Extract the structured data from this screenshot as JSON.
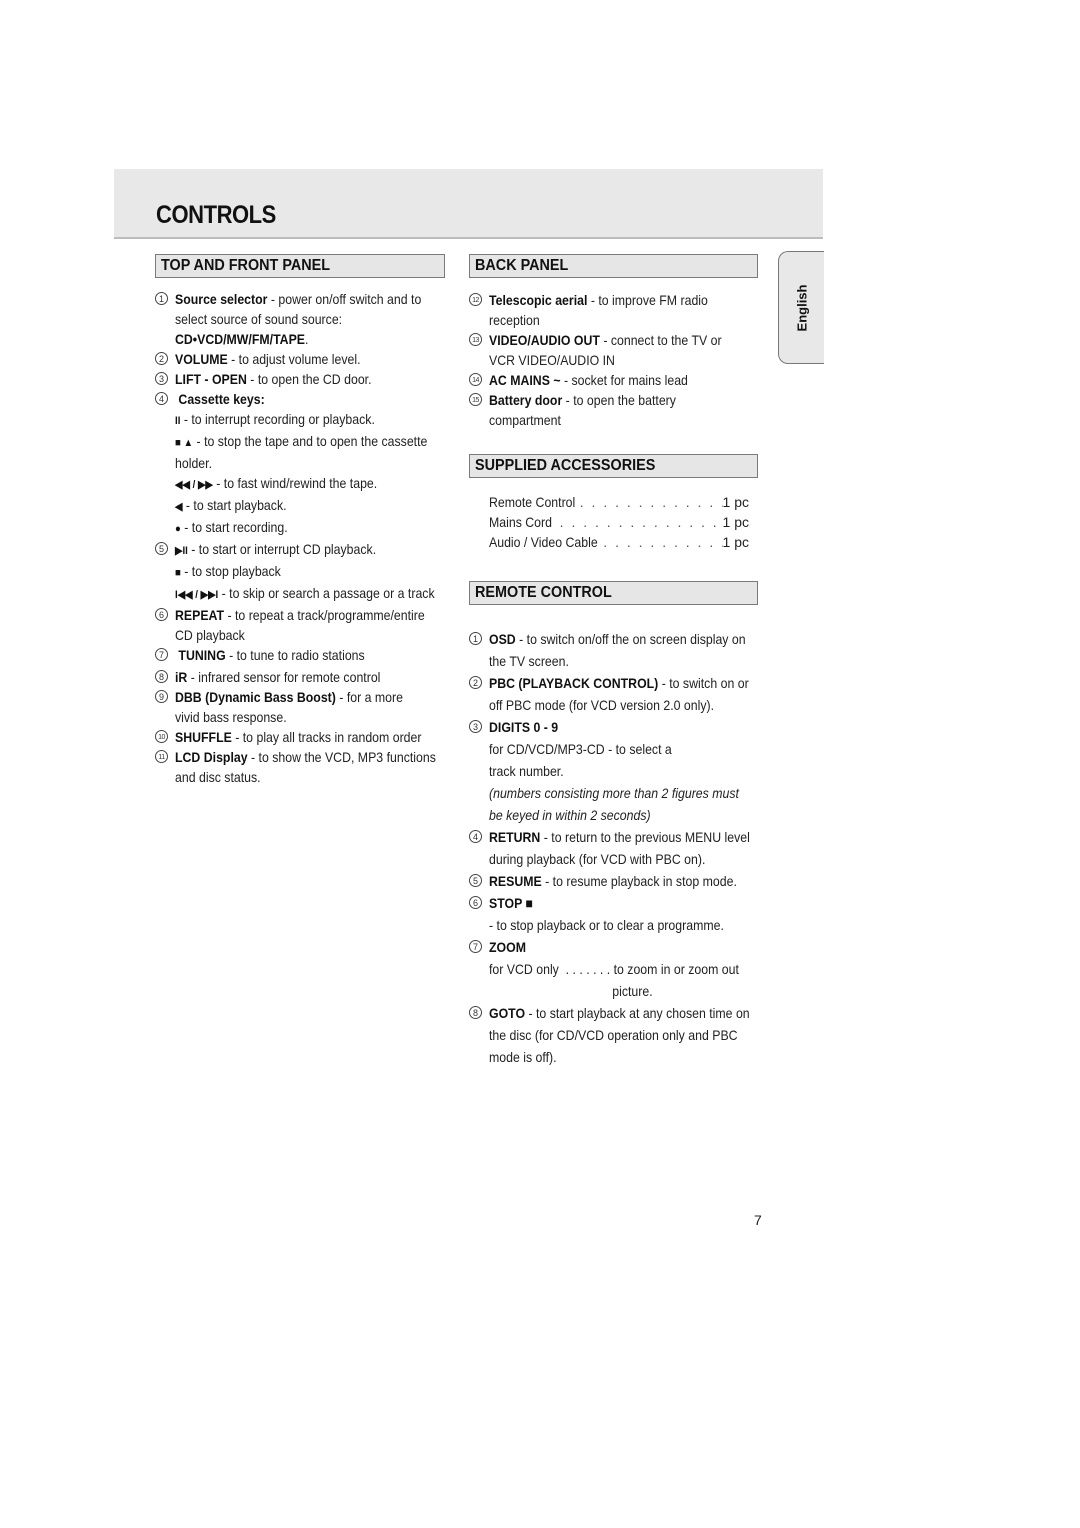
{
  "page": {
    "title": "CONTROLS",
    "language_tab": "English",
    "page_number": "7"
  },
  "top_front_panel": {
    "heading": "TOP AND FRONT PANEL",
    "items": [
      {
        "num": "1",
        "term": "Source selector",
        "desc": " - power on/off switch and to",
        "cont": [
          "select source of sound source:"
        ],
        "sub_bold": "CD•VCD/MW/FM/TAPE",
        "sub_tail": "."
      },
      {
        "num": "2",
        "term": "VOLUME",
        "desc": " - to adjust volume level."
      },
      {
        "num": "3",
        "term": "LIFT - OPEN",
        "desc": " - to open the CD door."
      },
      {
        "num": "4",
        "term": "Cassette keys:",
        "desc": ""
      },
      {
        "num": "5",
        "symbol": "▶II",
        "desc": " - to start or interrupt CD playback."
      },
      {
        "num": "6",
        "term": "REPEAT",
        "desc": " - to repeat a track/programme/entire",
        "cont": [
          "CD playback"
        ]
      },
      {
        "num": "7",
        "term": "TUNING",
        "desc": " - to tune to radio stations"
      },
      {
        "num": "8",
        "term": "iR",
        "desc": " - infrared sensor for remote control"
      },
      {
        "num": "9",
        "term": "DBB (Dynamic Bass Boost)",
        "desc": " -  for a more",
        "cont": [
          "vivid bass response."
        ]
      },
      {
        "num": "10",
        "term": "SHUFFLE",
        "desc": " - to play all tracks in random order"
      },
      {
        "num": "11",
        "term": "LCD Display",
        "desc": " - to show the VCD, MP3 functions",
        "cont": [
          "and disc status."
        ]
      }
    ],
    "cassette_keys": [
      {
        "symbol": "II",
        "desc": " - to interrupt recording or playback."
      },
      {
        "symbol": "■ ▲",
        "desc": " - to stop the tape and to open the cassette",
        "cont": "holder."
      },
      {
        "symbol": "◀◀ / ▶▶",
        "desc": " - to fast wind/rewind the tape."
      },
      {
        "symbol": "◀",
        "desc": " - to start playback."
      },
      {
        "symbol": "●",
        "desc": " - to start recording."
      }
    ],
    "cd_keys": [
      {
        "symbol": "■",
        "desc": " - to stop playback"
      },
      {
        "symbol": "I◀◀ / ▶▶I",
        "desc": " - to skip or search a passage or a track"
      }
    ]
  },
  "back_panel": {
    "heading": "BACK PANEL",
    "items": [
      {
        "num": "12",
        "term": "Telescopic aerial",
        "desc": " - to improve FM radio",
        "cont": "reception"
      },
      {
        "num": "13",
        "term": "VIDEO/AUDIO OUT",
        "desc": " - connect to the TV or",
        "cont": "VCR VIDEO/AUDIO IN"
      },
      {
        "num": "14",
        "term": "AC MAINS ~",
        "desc": " - socket for mains lead"
      },
      {
        "num": "15",
        "term": "Battery door",
        "desc": " - to open the battery",
        "cont": "compartment"
      }
    ]
  },
  "supplied_accessories": {
    "heading": "SUPPLIED ACCESSORIES",
    "items": [
      {
        "name": "Remote Control",
        "qty": "1 pc"
      },
      {
        "name": "Mains Cord",
        "qty": "1 pc"
      },
      {
        "name": "Audio / Video Cable",
        "qty": "1 pc"
      }
    ]
  },
  "remote_control": {
    "heading": "REMOTE CONTROL",
    "items": [
      {
        "num": "1",
        "term": "OSD",
        "desc": " - to switch on/off the on screen display on",
        "cont": [
          "the TV screen."
        ]
      },
      {
        "num": "2",
        "term": "PBC (PLAYBACK CONTROL)",
        "desc": " - to switch on or",
        "cont": [
          "off PBC mode (for VCD version 2.0 only)."
        ]
      },
      {
        "num": "3",
        "term": "DIGITS 0 - 9",
        "desc": "",
        "cont": [
          "for CD/VCD/MP3-CD - to select a",
          "track number."
        ],
        "note": [
          "(numbers consisting more than 2 figures must",
          "be keyed in within 2 seconds)"
        ]
      },
      {
        "num": "4",
        "term": "RETURN",
        "desc": " - to return to the previous MENU level",
        "cont": [
          "during playback (for VCD with PBC on)."
        ]
      },
      {
        "num": "5",
        "term": "RESUME",
        "desc": " - to resume playback in stop mode."
      },
      {
        "num": "6",
        "term": "STOP ■",
        "desc": "",
        "cont": [
          "- to stop playback or to clear a programme."
        ]
      },
      {
        "num": "7",
        "term": "ZOOM",
        "desc": "",
        "cont": [
          "for VCD only  . . . . . . . to zoom in or zoom out",
          "                                    picture."
        ]
      },
      {
        "num": "8",
        "term": "GOTO",
        "desc": " - to start playback at any chosen time on",
        "cont": [
          "the disc (for CD/VCD operation only and PBC",
          "mode is off)."
        ]
      }
    ]
  }
}
